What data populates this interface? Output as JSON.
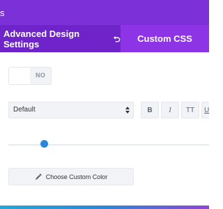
{
  "window": {
    "title_fragment": "s"
  },
  "tabs": [
    {
      "label": "Advanced Design Settings",
      "active": true
    },
    {
      "label": "Custom CSS",
      "active": false
    }
  ],
  "toggle": {
    "state_label": "NO"
  },
  "font_select": {
    "value": "Default"
  },
  "format_buttons": [
    {
      "label": "B",
      "name": "bold"
    },
    {
      "label": "I",
      "name": "italic"
    },
    {
      "label": "TT",
      "name": "uppercase"
    },
    {
      "label": "U",
      "name": "underline"
    }
  ],
  "slider": {
    "value_fraction": 0.18
  },
  "color_button": {
    "label": "Choose Custom Color"
  },
  "colors": {
    "accent": "#7b30d8",
    "tab_active": "#6e24c9",
    "tab_bar": "#8c34e6",
    "slider": "#2b87da"
  }
}
